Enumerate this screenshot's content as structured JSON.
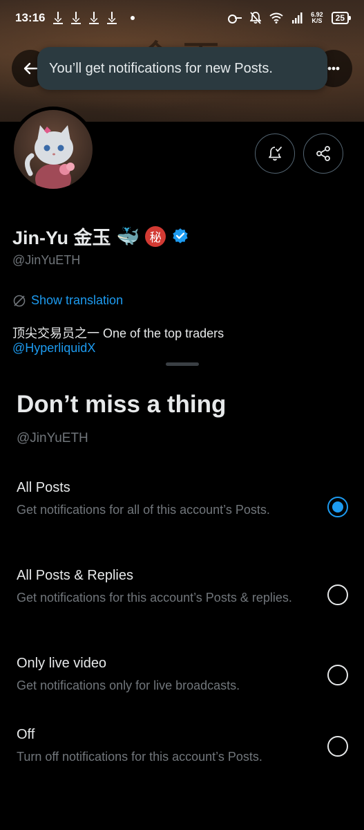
{
  "status_bar": {
    "time": "13:16",
    "net_speed_value": "6.92",
    "net_speed_unit": "K/S",
    "battery": "25"
  },
  "toast": {
    "message": "You’ll get notifications for new Posts."
  },
  "profile": {
    "name": "Jin-Yu 金玉",
    "emoji": "🐳",
    "badge_glyph": "秘",
    "handle": "@JinYuETH",
    "translate_label": "Show translation",
    "bio": "顶尖交易员之一 One of the top traders",
    "bio_link": "@HyperliquidX"
  },
  "sheet": {
    "title": "Don’t miss a thing",
    "handle": "@JinYuETH",
    "options": [
      {
        "label": "All Posts",
        "description": "Get notifications for all of this account’s Posts.",
        "selected": true
      },
      {
        "label": "All Posts & Replies",
        "description": "Get notifications for this account’s Posts & replies.",
        "selected": false
      },
      {
        "label": "Only live video",
        "description": "Get notifications only for live broadcasts.",
        "selected": false
      },
      {
        "label": "Off",
        "description": "Turn off notifications for this account’s Posts.",
        "selected": false
      }
    ]
  },
  "colors": {
    "accent": "#1d9bf0",
    "background": "#000000",
    "secondary_text": "#71767b",
    "toast_bg": "#2b3a40"
  }
}
